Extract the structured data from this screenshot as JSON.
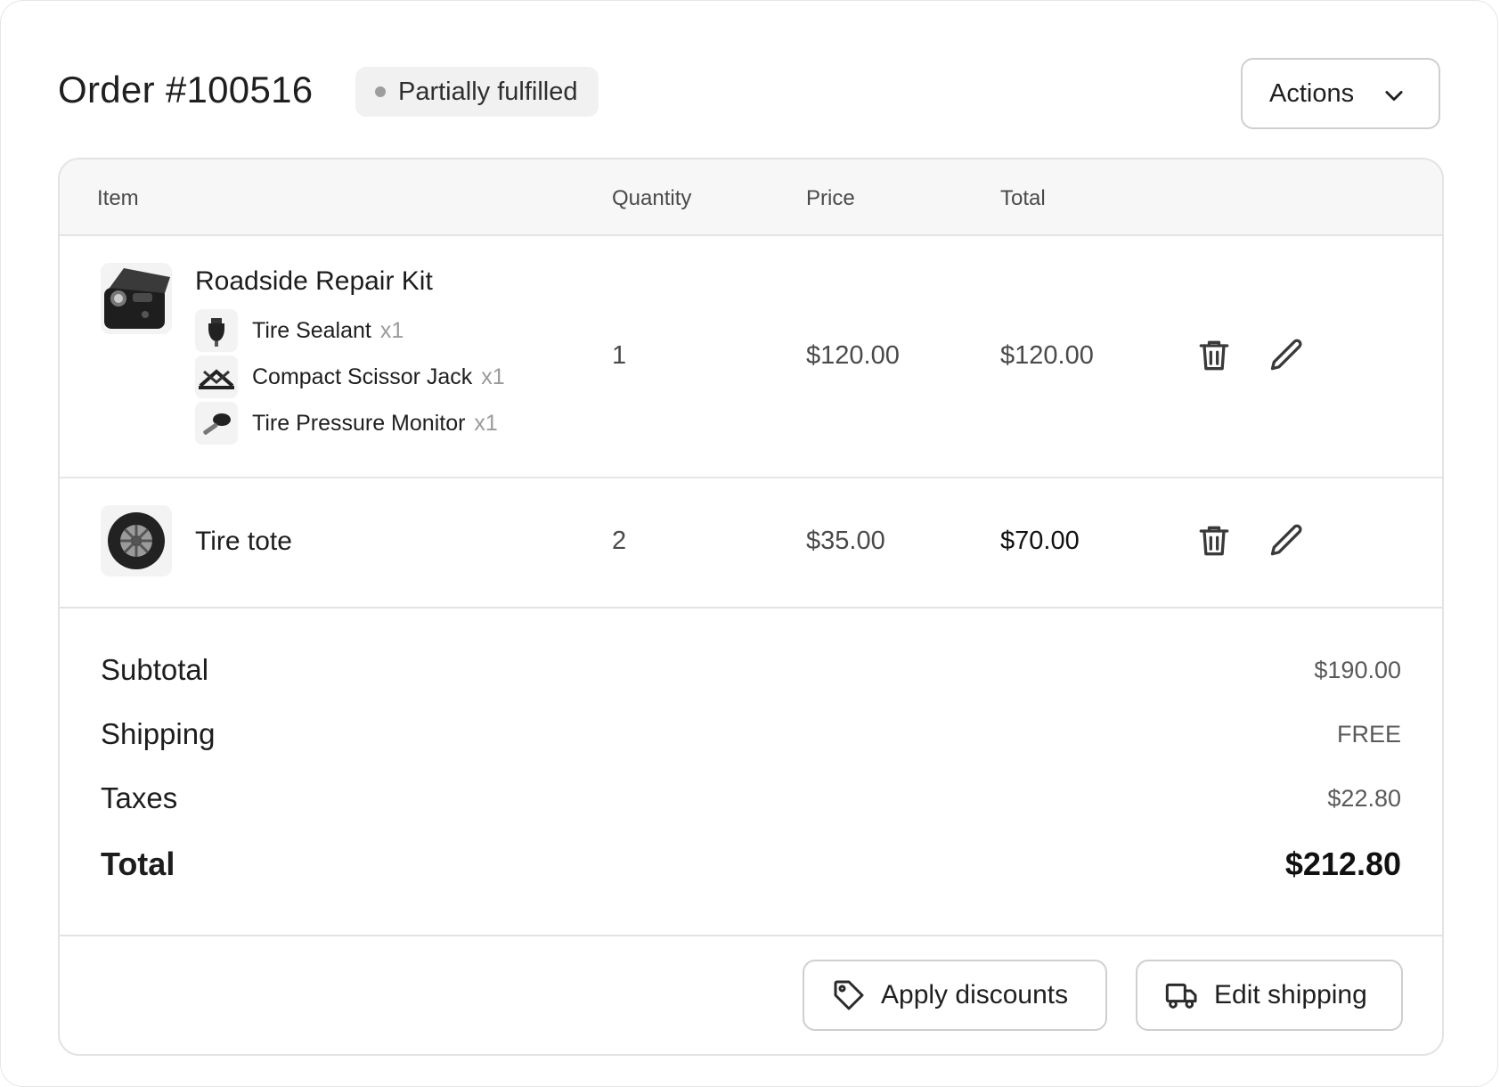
{
  "order": {
    "title": "Order #100516",
    "status": "Partially fulfilled",
    "actions_label": "Actions"
  },
  "table": {
    "headers": {
      "item": "Item",
      "quantity": "Quantity",
      "price": "Price",
      "total": "Total"
    },
    "rows": [
      {
        "name": "Roadside Repair Kit",
        "quantity": "1",
        "price": "$120.00",
        "total": "$120.00",
        "components": [
          {
            "name": "Tire Sealant",
            "qty": "x1",
            "icon": "sealant-bottle-icon"
          },
          {
            "name": "Compact Scissor Jack",
            "qty": "x1",
            "icon": "scissor-jack-icon"
          },
          {
            "name": "Tire Pressure Monitor",
            "qty": "x1",
            "icon": "pressure-sensor-icon"
          }
        ]
      },
      {
        "name": "Tire tote",
        "quantity": "2",
        "price": "$35.00",
        "total": "$70.00"
      }
    ]
  },
  "summary": {
    "subtotal_label": "Subtotal",
    "subtotal_value": "$190.00",
    "shipping_label": "Shipping",
    "shipping_value": "FREE",
    "taxes_label": "Taxes",
    "taxes_value": "$22.80",
    "total_label": "Total",
    "total_value": "$212.80"
  },
  "footer": {
    "apply_discounts": "Apply discounts",
    "edit_shipping": "Edit shipping"
  },
  "icons": {
    "actions": "chevron-down-icon",
    "delete": "trash-icon",
    "edit": "pencil-icon",
    "discount": "tag-icon",
    "shipping": "truck-icon"
  },
  "colors": {
    "border": "#e3e3e3",
    "header_bg": "#f7f7f7",
    "badge_bg": "#f1f1f1",
    "badge_dot": "#9d9d9d",
    "muted_text": "#9a9a9a"
  }
}
